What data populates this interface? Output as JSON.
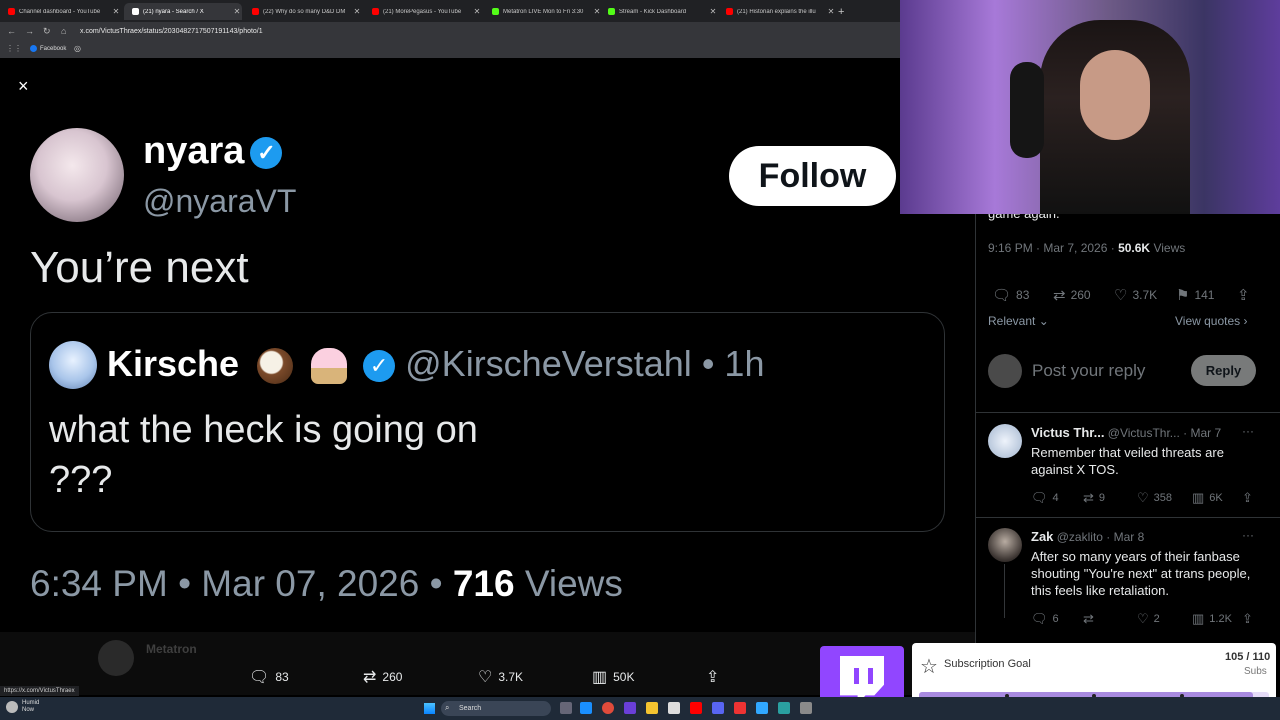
{
  "browser": {
    "tabs": [
      {
        "label": "Channel dashboard - YouTube",
        "color": "#ff0000",
        "active": false
      },
      {
        "label": "(21) nyara - Search / X",
        "color": "#ffffff",
        "active": true
      },
      {
        "label": "(22) Why do so many D&D DM",
        "color": "#ff0000",
        "active": false
      },
      {
        "label": "(21) MorePegasus - YouTube",
        "color": "#ff0000",
        "active": false
      },
      {
        "label": "Metatron LIVE Mon to Fri 3:30",
        "color": "#53fc18",
        "active": false
      },
      {
        "label": "Stream - Kick Dashboard",
        "color": "#53fc18",
        "active": false
      },
      {
        "label": "(21) Historian explains the illu",
        "color": "#ff0000",
        "active": false
      }
    ],
    "new_tab": "+",
    "url": "x.com/VictusThraex/status/2030482717507191143/photo/1",
    "bookmark": "Facebook",
    "status_url": "https://x.com/VictusThraex"
  },
  "post": {
    "close": "×",
    "author_name": "nyara",
    "author_handle": "@nyaraVT",
    "verified_glyph": "✓",
    "follow_label": "Follow",
    "text": "You’re next",
    "quote": {
      "name": "Kirsche",
      "handle": "@KirscheVerstahl",
      "time": "• 1h",
      "line1": "what the heck is going on",
      "line2": "???"
    },
    "time": "6:34 PM • Mar 07, 2026 •",
    "views_count": "716",
    "views_label": "Views"
  },
  "actionbar": {
    "blurred_name": "Metatron",
    "replies": "83",
    "reposts": "260",
    "likes": "3.7K",
    "views": "50K",
    "icons": {
      "reply": "speech-bubble",
      "repost": "repost-arrows",
      "like": "heart",
      "views": "bar-chart",
      "share": "upload"
    }
  },
  "sidebar": {
    "cutoff_text": "game again.",
    "meta_time": "9:16 PM · Mar 7, 2026 ·",
    "meta_views_count": "50.6K",
    "meta_views_label": "Views",
    "stats": {
      "replies": "83",
      "reposts": "260",
      "likes": "3.7K",
      "bookmarks": "141"
    },
    "sort_label": "Relevant",
    "view_quotes": "View quotes",
    "reply_placeholder": "Post your reply",
    "reply_button": "Reply",
    "comments": [
      {
        "name": "Victus Thr...",
        "handle": "@VictusThr...",
        "date": "· Mar 7",
        "text": "Remember that veiled threats are against X TOS.",
        "replies": "4",
        "reposts": "9",
        "likes": "358",
        "views": "6K"
      },
      {
        "name": "Zak",
        "handle": "@zaklito",
        "date": "· Mar 8",
        "text": "After so many years of their fanbase shouting \"You're next\" at trans people, this feels like retaliation.",
        "replies": "6",
        "reposts": "",
        "likes": "2",
        "views": "1.2K"
      }
    ]
  },
  "overlay": {
    "sub_goal_title": "Subscription Goal",
    "sub_count": "105 / 110",
    "sub_unit": "Subs",
    "sub_progress": 0.9545
  },
  "taskbar": {
    "weather_line1": "Humid",
    "weather_line2": "Now",
    "search_label": "Search"
  }
}
